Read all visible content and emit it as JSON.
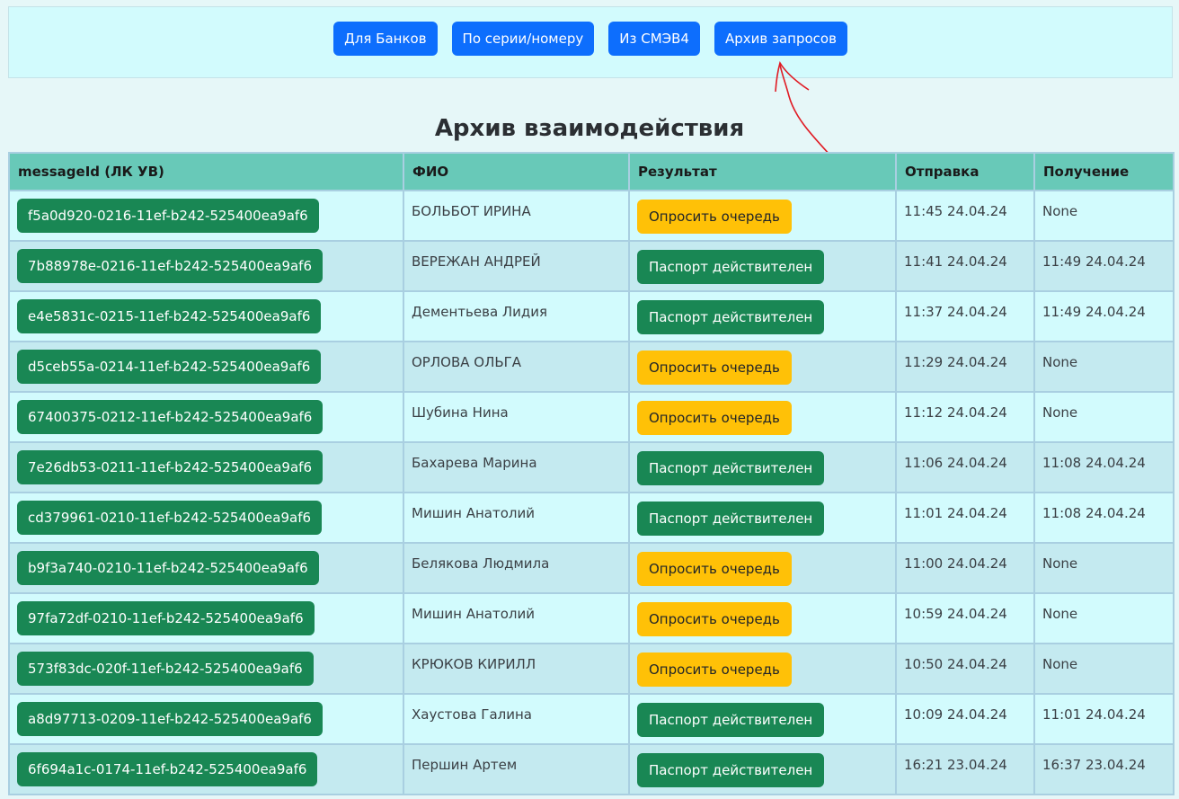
{
  "nav": {
    "buttons": [
      "Для Банков",
      "По серии/номеру",
      "Из СМЭВ4",
      "Архив запросов"
    ]
  },
  "page_title": "Архив взаимодействия",
  "table": {
    "headers": [
      "messageId (ЛК УВ)",
      "ФИО",
      "Результат",
      "Отправка",
      "Получение"
    ],
    "rows": [
      {
        "id": "f5a0d920-0216-11ef-b242-525400ea9af6",
        "fio": "БОЛЬБОТ ИРИНА",
        "result": "Опросить очередь",
        "status": "warn",
        "sent": "11:45 24.04.24",
        "received": "None"
      },
      {
        "id": "7b88978e-0216-11ef-b242-525400ea9af6",
        "fio": "ВЕРЕЖАН АНДРЕЙ",
        "result": "Паспорт действителен",
        "status": "ok",
        "sent": "11:41 24.04.24",
        "received": "11:49 24.04.24"
      },
      {
        "id": "e4e5831c-0215-11ef-b242-525400ea9af6",
        "fio": "Дементьева Лидия",
        "result": "Паспорт действителен",
        "status": "ok",
        "sent": "11:37 24.04.24",
        "received": "11:49 24.04.24"
      },
      {
        "id": "d5ceb55a-0214-11ef-b242-525400ea9af6",
        "fio": "ОРЛОВА ОЛЬГА",
        "result": "Опросить очередь",
        "status": "warn",
        "sent": "11:29 24.04.24",
        "received": "None"
      },
      {
        "id": "67400375-0212-11ef-b242-525400ea9af6",
        "fio": "Шубина Нина",
        "result": "Опросить очередь",
        "status": "warn",
        "sent": "11:12 24.04.24",
        "received": "None"
      },
      {
        "id": "7e26db53-0211-11ef-b242-525400ea9af6",
        "fio": "Бахарева Марина",
        "result": "Паспорт действителен",
        "status": "ok",
        "sent": "11:06 24.04.24",
        "received": "11:08 24.04.24"
      },
      {
        "id": "cd379961-0210-11ef-b242-525400ea9af6",
        "fio": "Мишин Анатолий",
        "result": "Паспорт действителен",
        "status": "ok",
        "sent": "11:01 24.04.24",
        "received": "11:08 24.04.24"
      },
      {
        "id": "b9f3a740-0210-11ef-b242-525400ea9af6",
        "fio": "Белякова Людмила",
        "result": "Опросить очередь",
        "status": "warn",
        "sent": "11:00 24.04.24",
        "received": "None"
      },
      {
        "id": "97fa72df-0210-11ef-b242-525400ea9af6",
        "fio": "Мишин Анатолий",
        "result": "Опросить очередь",
        "status": "warn",
        "sent": "10:59 24.04.24",
        "received": "None"
      },
      {
        "id": "573f83dc-020f-11ef-b242-525400ea9af6",
        "fio": "КРЮКОВ КИРИЛЛ",
        "result": "Опросить очередь",
        "status": "warn",
        "sent": "10:50 24.04.24",
        "received": "None"
      },
      {
        "id": "a8d97713-0209-11ef-b242-525400ea9af6",
        "fio": "Хаустова Галина",
        "result": "Паспорт действителен",
        "status": "ok",
        "sent": "10:09 24.04.24",
        "received": "11:01 24.04.24"
      },
      {
        "id": "6f694a1c-0174-11ef-b242-525400ea9af6",
        "fio": "Першин Артем",
        "result": "Паспорт действителен",
        "status": "ok",
        "sent": "16:21 23.04.24",
        "received": "16:37 23.04.24"
      }
    ]
  },
  "colors": {
    "primary": "#0d6efd",
    "success": "#198754",
    "warning": "#ffc107",
    "header_bg": "#68c9b8",
    "annotation": "#e01b24"
  }
}
